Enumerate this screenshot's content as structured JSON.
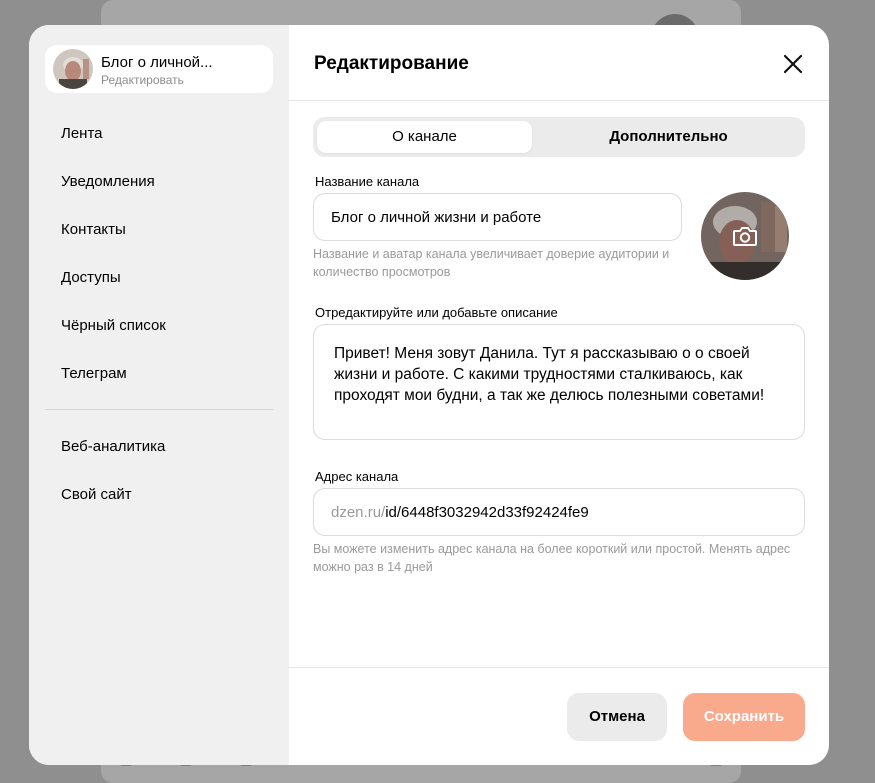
{
  "sidebar": {
    "channel": {
      "name": "Блог о личной...",
      "edit_label": "Редактировать"
    },
    "items": [
      {
        "label": "Лента"
      },
      {
        "label": "Уведомления"
      },
      {
        "label": "Контакты"
      },
      {
        "label": "Доступы"
      },
      {
        "label": "Чёрный список"
      },
      {
        "label": "Телеграм"
      },
      {
        "label": "Веб-аналитика"
      },
      {
        "label": "Свой сайт"
      }
    ]
  },
  "header": {
    "title": "Редактирование",
    "close_icon": "close-icon"
  },
  "tabs": [
    {
      "label": "О канале",
      "active": true
    },
    {
      "label": "Дополнительно",
      "active": false
    }
  ],
  "form": {
    "name_label": "Название канала",
    "name_value": "Блог о личной жизни и работе",
    "name_hint": "Название и аватар канала увеличивает доверие аудитории и количество просмотров",
    "avatar_icon": "camera-icon",
    "description_label": "Отредактируйте или добавьте описание",
    "description_value": "Привет! Меня зовут Данила. Тут я рассказываю о о своей жизни и работе. С какими трудностями сталкиваюсь, как проходят мои будни, а так же делюсь полезными советами!",
    "address_label": "Адрес канала",
    "address_prefix": "dzen.ru/",
    "address_value": "id/6448f3032942d33f92424fe9",
    "address_hint": "Вы можете изменить адрес канала на более короткий или простой. Менять адрес можно раз в 14 дней"
  },
  "footer": {
    "cancel_label": "Отмена",
    "save_label": "Сохранить"
  },
  "colors": {
    "accent_save": "#f9a98c",
    "sidebar_bg": "#f0f0f0",
    "overlay": "#8f8f8f"
  }
}
